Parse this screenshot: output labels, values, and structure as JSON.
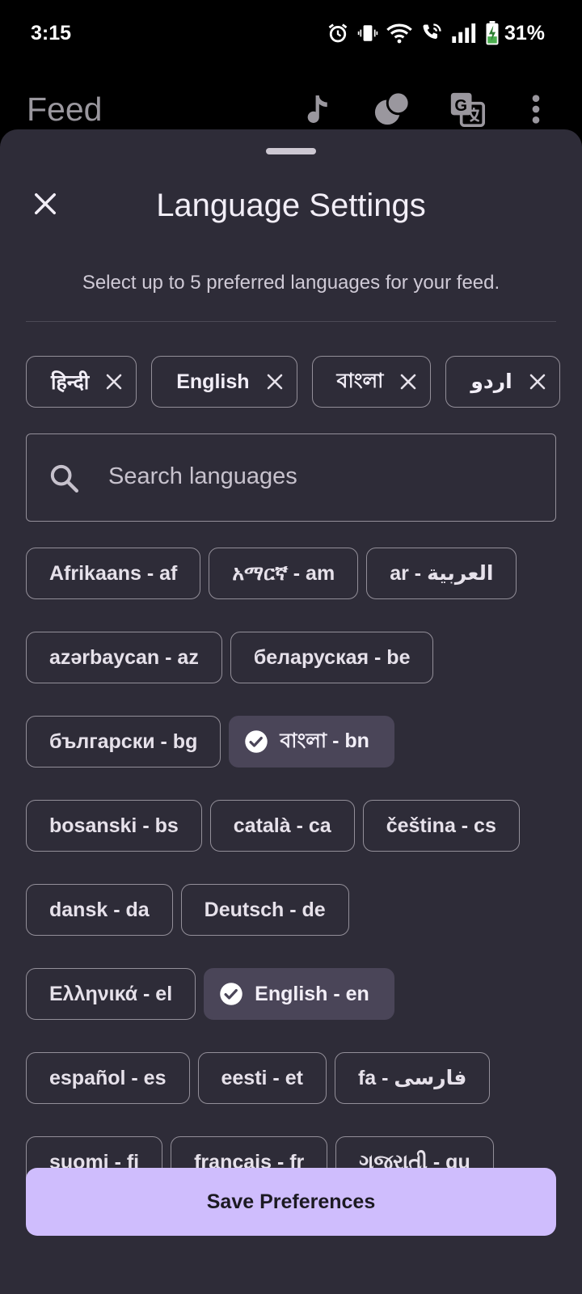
{
  "status_bar": {
    "time": "3:15",
    "battery": "31%"
  },
  "app_bar": {
    "title": "Feed"
  },
  "sheet": {
    "title": "Language Settings",
    "subtitle": "Select up to 5 preferred languages for your feed."
  },
  "selected_chips": [
    "हिन्दी",
    "English",
    "বাংলা",
    "اردو"
  ],
  "search": {
    "placeholder": "Search languages"
  },
  "languages": [
    [
      {
        "label": "Afrikaans - af",
        "selected": false
      },
      {
        "label": "አማርኛ - am",
        "selected": false
      },
      {
        "label": "ar - العربية",
        "selected": false
      }
    ],
    [
      {
        "label": "azərbaycan - az",
        "selected": false
      },
      {
        "label": "беларуская - be",
        "selected": false
      }
    ],
    [
      {
        "label": "български - bg",
        "selected": false
      },
      {
        "label": "বাংলা - bn",
        "selected": true
      }
    ],
    [
      {
        "label": "bosanski - bs",
        "selected": false
      },
      {
        "label": "català - ca",
        "selected": false
      },
      {
        "label": "čeština - cs",
        "selected": false
      }
    ],
    [
      {
        "label": "dansk - da",
        "selected": false
      },
      {
        "label": "Deutsch - de",
        "selected": false
      }
    ],
    [
      {
        "label": "Ελληνικά - el",
        "selected": false
      },
      {
        "label": "English - en",
        "selected": true
      }
    ],
    [
      {
        "label": "español - es",
        "selected": false
      },
      {
        "label": "eesti - et",
        "selected": false
      },
      {
        "label": "fa - فارسی",
        "selected": false
      }
    ],
    [
      {
        "label": "suomi - fi",
        "selected": false
      },
      {
        "label": "français - fr",
        "selected": false
      },
      {
        "label": "ગુજરાતી - gu",
        "selected": false
      }
    ]
  ],
  "save_button": {
    "label": "Save Preferences"
  },
  "colors": {
    "sheet_bg": "#2e2c38",
    "chip_border": "#938f99",
    "selected_chip_bg": "#4a4558",
    "primary_button": "#cfbdfd"
  }
}
